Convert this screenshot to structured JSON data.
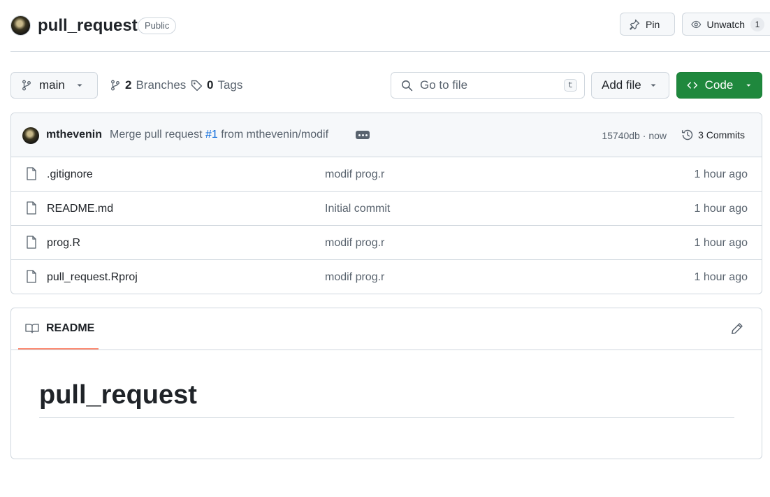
{
  "repo": {
    "name": "pull_request",
    "visibility": "Public",
    "pin_label": "Pin",
    "watch_label": "Unwatch",
    "watch_count": "1"
  },
  "toolbar": {
    "branch": "main",
    "branches_count": "2",
    "branches_label": "Branches",
    "tags_count": "0",
    "tags_label": "Tags",
    "search_placeholder": "Go to file",
    "search_shortcut": "t",
    "add_file_label": "Add file",
    "code_label": "Code"
  },
  "commit": {
    "author": "mthevenin",
    "message_prefix": "Merge pull request",
    "pr_link": "#1",
    "message_suffix": "from mthevenin/modif",
    "hash": "15740db",
    "separator": "·",
    "time": "now",
    "commits_label": "3 Commits"
  },
  "files": [
    {
      "name": ".gitignore",
      "message": "modif prog.r",
      "time": "1 hour ago"
    },
    {
      "name": "README.md",
      "message": "Initial commit",
      "time": "1 hour ago"
    },
    {
      "name": "prog.R",
      "message": "modif prog.r",
      "time": "1 hour ago"
    },
    {
      "name": "pull_request.Rproj",
      "message": "modif prog.r",
      "time": "1 hour ago"
    }
  ],
  "readme": {
    "tab_label": "README",
    "heading": "pull_request"
  },
  "colors": {
    "code_button": "#1f883d",
    "link": "#0969da",
    "tab_underline": "#fd8c73"
  },
  "icons": [
    "pin-icon",
    "eye-icon",
    "branch-icon",
    "tag-icon",
    "search-icon",
    "code-icon",
    "history-icon",
    "file-icon",
    "book-icon",
    "pencil-icon"
  ]
}
